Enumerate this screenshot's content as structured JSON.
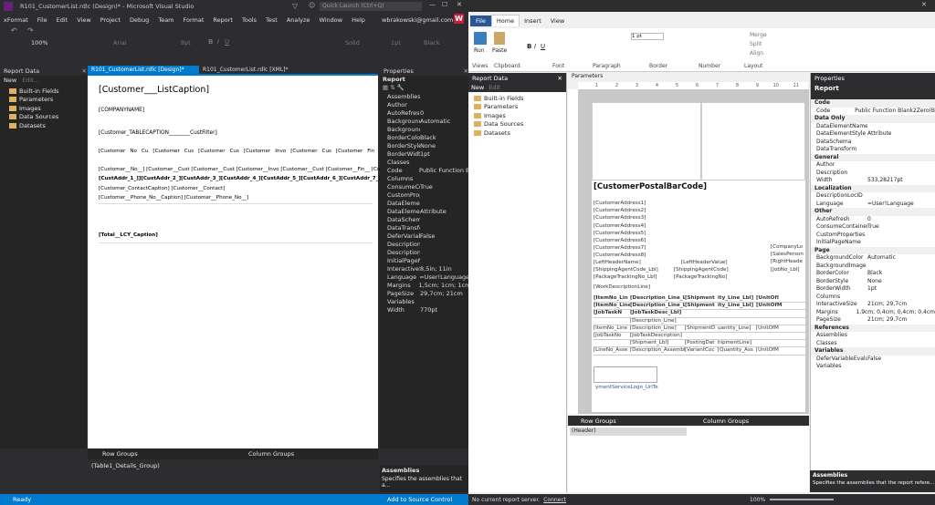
{
  "vs": {
    "title": "R101_CustomerList.rdlc (Design)* - Microsoft Visual Studio",
    "quick_launch": "Quick Launch (Ctrl+Q)",
    "user": "wbrakowski@gmail.com",
    "menu": [
      "xFormat",
      "File",
      "Edit",
      "View",
      "Project",
      "Debug",
      "Team",
      "Format",
      "Report",
      "Tools",
      "Test",
      "Analyze",
      "Window",
      "Help"
    ],
    "zoom": "100%",
    "font_name": "Arial",
    "font_size": "8pt",
    "border_style": "Solid",
    "border_width": "1pt",
    "border_color": "Black",
    "report_data": {
      "title": "Report Data",
      "new": "New",
      "edit": "Edit...",
      "items": [
        "Built-in Fields",
        "Parameters",
        "Images",
        "Data Sources",
        "Datasets"
      ]
    },
    "tabs": [
      "R101_CustomerList.rdlc [Design]*",
      "R101_CustomerList.rdlc [XML]*"
    ],
    "design": {
      "caption": "[Customer___ListCaption]",
      "company": "[COMPANYNAME]",
      "tablecaption": "[Customer_TABLECAPTION________CustFilter]",
      "headers": [
        "[Customer",
        "No",
        "Cu",
        "[Customer",
        "Cus",
        "[Customer",
        "Cus",
        "[Customer",
        "Invo",
        "[Customer",
        "Cus",
        "[Customer",
        "Fin",
        "[Cust"
      ],
      "line1": "[Customer__No__]    [Customer__Cust [Customer__Cust [Customer__Invo [Customer__Cust [Customer__Fin__ [Cust",
      "line2": "[CustAddr_1_]][CustAddr_2_][CustAddr_3_][CustAddr_4_][CustAddr_5_][CustAddr_6_][CustAddr_7_]",
      "line3": "[Customer_ContactCaption]  [Customer__Contact]",
      "line4": "[Customer__Phone_No__Caption]  [Customer__Phone_No__]",
      "total": "[Total__LCY_Caption]"
    },
    "properties": {
      "title": "Properties",
      "object": "Report",
      "rows": [
        [
          "Assemblies",
          ""
        ],
        [
          "Author",
          ""
        ],
        [
          "AutoRefresh",
          "0"
        ],
        [
          "Background",
          "Automatic"
        ],
        [
          "Background",
          ""
        ],
        [
          "BorderColor",
          "Black"
        ],
        [
          "BorderStyle",
          "None"
        ],
        [
          "BorderWidth",
          "1pt"
        ],
        [
          "Classes",
          ""
        ],
        [
          "Code",
          "Public Function B"
        ],
        [
          "Columns",
          ""
        ],
        [
          "ConsumeCo",
          "True"
        ],
        [
          "CustomProp",
          ""
        ],
        [
          "DataElemen",
          ""
        ],
        [
          "DataElemen",
          "Attribute"
        ],
        [
          "DataSchema",
          ""
        ],
        [
          "DataTransfo",
          ""
        ],
        [
          "DeferVariabl",
          "False"
        ],
        [
          "Description",
          ""
        ],
        [
          "Description",
          ""
        ],
        [
          "InitialPageN",
          ""
        ],
        [
          "InteractiveSi",
          "8,5in; 11in"
        ],
        [
          "Language",
          "=User!Language"
        ],
        [
          "Margins",
          "1,5cm; 1cm; 1cm"
        ],
        [
          "PageSize",
          "29,7cm; 21cm"
        ],
        [
          "Variables",
          ""
        ],
        [
          "Width",
          "770pt"
        ]
      ],
      "help_title": "Assemblies",
      "help_text": "Specifies the assemblies that a..."
    },
    "groups": {
      "row": "Row Groups",
      "col": "Column Groups",
      "detail": "(Table1_Details_Group)"
    },
    "status": {
      "ready": "Ready",
      "source": "Add to Source Control"
    }
  },
  "rb": {
    "title": "",
    "tabs": [
      "File",
      "Home",
      "Insert",
      "View"
    ],
    "ribbon_groups": [
      "Views",
      "Clipboard",
      "Font",
      "Paragraph",
      "Border",
      "Number",
      "Layout"
    ],
    "run": "Run",
    "paste": "Paste",
    "merge": "Merge",
    "split": "Split",
    "align": "Align",
    "font_size": "1 pt",
    "report_data": {
      "title": "Report Data",
      "new": "New",
      "edit": "Edit",
      "items": [
        "Built-in Fields",
        "Parameters",
        "Images",
        "Data Sources",
        "Datasets"
      ]
    },
    "parameters_label": "Parameters",
    "ruler": [
      "1",
      "2",
      "3",
      "4",
      "5",
      "6",
      "7",
      "8",
      "9",
      "10",
      "11"
    ],
    "barcode": "[CustomerPostalBarCode]",
    "addresses": [
      "[CustomerAddress1]",
      "[CustomerAddress2]",
      "[CustomerAddress3]",
      "[CustomerAddress4]",
      "[CustomerAddress5]",
      "[CustomerAddress6]",
      "[CustomerAddress7]",
      "[CustomerAddress8]"
    ],
    "right_labels": [
      "[CompanyLo",
      "[SalesPerson",
      "[RightHeade",
      "[JobNo_Lbl]"
    ],
    "header_line": [
      "[LeftHeaderName]",
      "[LeftHeaderValue]"
    ],
    "ship_line": [
      "[ShippingAgentCode_Lbl]",
      "[ShippingAgentCode]"
    ],
    "pkg_line": [
      "[PackageTrackingNo_Lbl]",
      "[PackageTrackingNo]"
    ],
    "work": "[WorkDescriptionLine]",
    "table_head": [
      "[ItemNo_Lin",
      "[Description_Line_Lbl]",
      "[Shipment",
      "ity_Line_Lbl]",
      "[UnitOfI"
    ],
    "table_head2": [
      "[ItemNo_Line",
      "[Description_Line_Lbl]",
      "[Shipment",
      "ity_Line_Lbl]",
      "[UnitOfM"
    ],
    "job_head": [
      "[JobTaskN",
      "[JobTaskDesc_Lbl]"
    ],
    "detail_rows": [
      [
        "",
        "[Description_Line]",
        "",
        "",
        ""
      ],
      [
        "[ItemNo_Line",
        "[Description_Line]",
        "[ShipmentD",
        "uantity_Line]",
        "[UnitOfM"
      ],
      [
        "[JobTaskNo",
        "[JobTaskDescription]",
        "",
        "",
        ""
      ],
      [
        "",
        "[Shipment_Lbl]",
        "[PostingDat",
        "hipmentLine]",
        ""
      ],
      [
        "[LineNo_Asse",
        "[Description_AssemblyLine]",
        "[VariantCoc",
        "[Quantity_Ass",
        "[UnitOfM"
      ]
    ],
    "logo_url": "ymentServiceLogo_UrlTe",
    "groups": {
      "row": "Row Groups",
      "col": "Column Groups",
      "detail": "(Header)"
    },
    "properties": {
      "title": "Properties",
      "object": "Report",
      "cats": [
        {
          "name": "Code",
          "rows": [
            [
              "Code",
              "Public Function Blank2Zero(B"
            ]
          ]
        },
        {
          "name": "Data Only",
          "rows": [
            [
              "DataElementName",
              ""
            ],
            [
              "DataElementStyle",
              "Attribute"
            ],
            [
              "DataSchema",
              ""
            ],
            [
              "DataTransform",
              ""
            ]
          ]
        },
        {
          "name": "General",
          "rows": [
            [
              "Author",
              ""
            ],
            [
              "Description",
              ""
            ],
            [
              "Width",
              "533,28217pt"
            ]
          ]
        },
        {
          "name": "Localization",
          "rows": [
            [
              "DescriptionLocID",
              ""
            ],
            [
              "Language",
              "=User!Language"
            ]
          ]
        },
        {
          "name": "Other",
          "rows": [
            [
              "AutoRefresh",
              "0"
            ],
            [
              "ConsumeContainerWh",
              "True"
            ],
            [
              "CustomProperties",
              ""
            ],
            [
              "InitialPageName",
              ""
            ]
          ]
        },
        {
          "name": "Page",
          "rows": [
            [
              "BackgroundColor",
              "Automatic"
            ],
            [
              "BackgroundImage",
              ""
            ],
            [
              "BorderColor",
              "Black"
            ],
            [
              "BorderStyle",
              "None"
            ],
            [
              "BorderWidth",
              "1pt"
            ],
            [
              "Columns",
              ""
            ],
            [
              "InteractiveSize",
              "21cm; 29,7cm"
            ],
            [
              "Margins",
              "1,9cm; 0,4cm; 0,4cm; 0,4cm"
            ],
            [
              "PageSize",
              "21cm; 29,7cm"
            ]
          ]
        },
        {
          "name": "References",
          "rows": [
            [
              "Assemblies",
              ""
            ],
            [
              "Classes",
              ""
            ]
          ]
        },
        {
          "name": "Variables",
          "rows": [
            [
              "DeferVariableEvaluati",
              "False"
            ],
            [
              "Variables",
              ""
            ]
          ]
        }
      ],
      "help_title": "Assemblies",
      "help_text": "Specifies the assemblies that the report refere..."
    },
    "status": {
      "server": "No current report server.",
      "connect": "Connect",
      "zoom": "100%"
    }
  },
  "colors": {
    "vs_accent": "#007acc",
    "vs_bg": "#2d2d30",
    "rb_accent": "#2b579a"
  }
}
